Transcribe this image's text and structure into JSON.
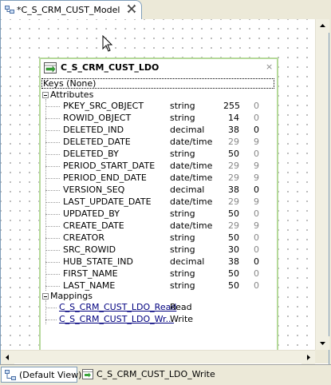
{
  "editor_tab": {
    "title": "*C_S_CRM_CUST_Model",
    "close_icon": "close-icon"
  },
  "node": {
    "title": "C_S_CRM_CUST_LDO",
    "close_glyph": "×",
    "keys_label": "Keys (None)",
    "attributes_label": "Attributes",
    "mappings_label": "Mappings",
    "attributes": [
      {
        "name": "PKEY_SRC_OBJECT",
        "type": "string",
        "length": "255",
        "scale": "0"
      },
      {
        "name": "ROWID_OBJECT",
        "type": "string",
        "length": "14",
        "scale": "0"
      },
      {
        "name": "DELETED_IND",
        "type": "decimal",
        "length": "38",
        "scale": "0"
      },
      {
        "name": "DELETED_DATE",
        "type": "date/time",
        "length": "29",
        "scale": "9"
      },
      {
        "name": "DELETED_BY",
        "type": "string",
        "length": "50",
        "scale": "0"
      },
      {
        "name": "PERIOD_START_DATE",
        "type": "date/time",
        "length": "29",
        "scale": "9"
      },
      {
        "name": "PERIOD_END_DATE",
        "type": "date/time",
        "length": "29",
        "scale": "9"
      },
      {
        "name": "VERSION_SEQ",
        "type": "decimal",
        "length": "38",
        "scale": "0"
      },
      {
        "name": "LAST_UPDATE_DATE",
        "type": "date/time",
        "length": "29",
        "scale": "9"
      },
      {
        "name": "UPDATED_BY",
        "type": "string",
        "length": "50",
        "scale": "0"
      },
      {
        "name": "CREATE_DATE",
        "type": "date/time",
        "length": "29",
        "scale": "9"
      },
      {
        "name": "CREATOR",
        "type": "string",
        "length": "50",
        "scale": "0"
      },
      {
        "name": "SRC_ROWID",
        "type": "string",
        "length": "30",
        "scale": "0"
      },
      {
        "name": "HUB_STATE_IND",
        "type": "decimal",
        "length": "38",
        "scale": "0"
      },
      {
        "name": "FIRST_NAME",
        "type": "string",
        "length": "50",
        "scale": "0"
      },
      {
        "name": "LAST_NAME",
        "type": "string",
        "length": "50",
        "scale": "0"
      }
    ],
    "mappings": [
      {
        "name": "C_S_CRM_CUST_LDO_Read",
        "mode": "Read"
      },
      {
        "name": "C_S_CRM_CUST_LDO_Wr...",
        "mode": "Write"
      }
    ]
  },
  "bottom_tabs": [
    {
      "label": "(Default View)"
    },
    {
      "label": "C_S_CRM_CUST_LDO_Write"
    }
  ],
  "colors": {
    "node_border": "#b5d99a",
    "link": "#00007f",
    "tab_border": "#7f9db9"
  }
}
